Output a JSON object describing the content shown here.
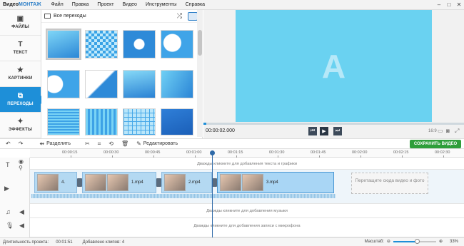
{
  "app": {
    "name_prefix": "Видео",
    "name_brand": "МОНТАЖ"
  },
  "menu": [
    "Файл",
    "Правка",
    "Проект",
    "Видео",
    "Инструменты",
    "Справка"
  ],
  "window_buttons": [
    "–",
    "□",
    "✕"
  ],
  "sidebar": {
    "items": [
      {
        "label": "ФАЙЛЫ",
        "icon": "image-icon",
        "glyph": "▣"
      },
      {
        "label": "ТЕКСТ",
        "icon": "text-icon",
        "glyph": "T"
      },
      {
        "label": "КАРТИНКИ",
        "icon": "star-icon",
        "glyph": "★"
      },
      {
        "label": "ПЕРЕХОДЫ",
        "icon": "transitions-icon",
        "glyph": "⧉",
        "active": true
      },
      {
        "label": "ЭФФЕКТЫ",
        "icon": "magic-wand-icon",
        "glyph": "✦"
      }
    ]
  },
  "library": {
    "header": "Все переходы",
    "shuffle_glyph": "⤮"
  },
  "preview": {
    "letter": "A",
    "timecode": "00:00:02.000",
    "aspect_ratio": "16:9",
    "progress": 0.01,
    "controls": [
      "⏮",
      "▶",
      "⏭"
    ]
  },
  "toolbar": {
    "undo": "↶",
    "redo": "↷",
    "split": "Разделить",
    "edit": "Редактировать",
    "save": "СОХРАНИТЬ ВИДЕО"
  },
  "ruler": {
    "ticks": [
      "00:00:15",
      "00:00:30",
      "00:00:45",
      "00:01:00",
      "00:01:15",
      "00:01:30",
      "00:01:45",
      "00:02:00",
      "00:02:15",
      "00:02:30"
    ]
  },
  "tracks": {
    "text_hint": "Дважды кликните для добавления текста и графики",
    "music_hint": "Дважды кликните для добавления музыки",
    "mic_hint": "Дважды кликните для добавления записи с микрофона",
    "dropzone": "Перетащите сюда видео и фото",
    "clips": [
      {
        "label": "4."
      },
      {
        "label": "1.mp4"
      },
      {
        "label": "2.mp4"
      },
      {
        "label": "3.mp4"
      }
    ]
  },
  "status": {
    "duration_label": "Длительность проекта:",
    "duration_value": "00:01:51",
    "clips_label": "Добавлено клипов:",
    "clips_value": "4",
    "scale_label": "Масштаб:",
    "scale_value": "33%"
  }
}
